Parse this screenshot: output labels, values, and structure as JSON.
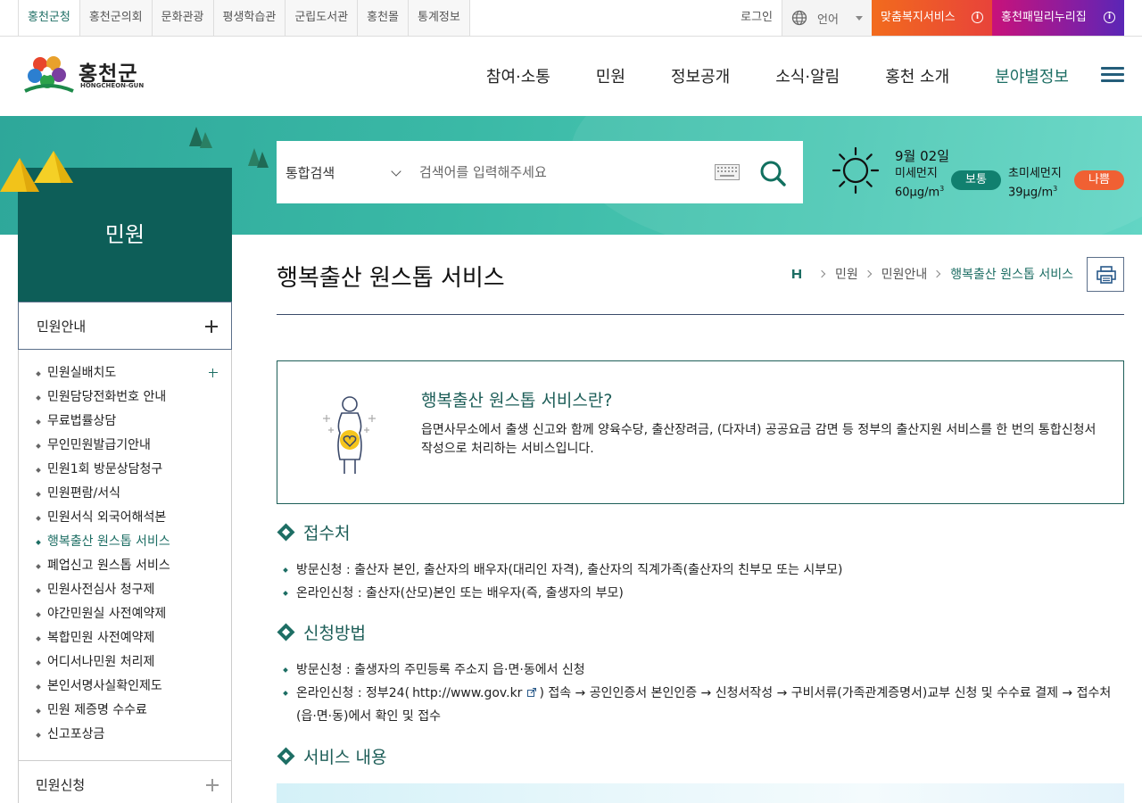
{
  "topbar": {
    "sites": [
      {
        "label": "홍천군청",
        "active": true
      },
      {
        "label": "홍천군의회"
      },
      {
        "label": "문화관광"
      },
      {
        "label": "평생학습관"
      },
      {
        "label": "군립도서관"
      },
      {
        "label": "홍천몰"
      },
      {
        "label": "통계정보"
      }
    ],
    "login": "로그인",
    "language": "언어",
    "promo_welfare": "맞춤복지서비스",
    "promo_family": "홍천패밀리누리집"
  },
  "header": {
    "logo_name": "홍천군",
    "logo_eng": "HONGCHEON-GUN",
    "gnb": [
      {
        "label": "참여·소통"
      },
      {
        "label": "민원"
      },
      {
        "label": "정보공개"
      },
      {
        "label": "소식·알림"
      },
      {
        "label": "홍천 소개"
      },
      {
        "label": "분야별정보",
        "active": true
      }
    ]
  },
  "search": {
    "scope": "통합검색",
    "placeholder": "검색어를 입력해주세요"
  },
  "weather": {
    "date": "9월 02일",
    "pm10_label": "미세먼지",
    "pm10_value": "60μg/m",
    "pm10_unit_exp": "3",
    "pm10_status": "보통",
    "pm25_label": "초미세먼지",
    "pm25_value": "39μg/m",
    "pm25_unit_exp": "3",
    "pm25_status": "나쁨"
  },
  "lnb": {
    "title": "민원",
    "group_open": "민원안내",
    "items": [
      {
        "label": "민원실배치도",
        "has_sub": true
      },
      {
        "label": "민원담당전화번호 안내"
      },
      {
        "label": "무료법률상담"
      },
      {
        "label": "무인민원발급기안내"
      },
      {
        "label": "민원1회 방문상담청구"
      },
      {
        "label": "민원편람/서식"
      },
      {
        "label": "민원서식 외국어해석본"
      },
      {
        "label": "행복출산 원스톱 서비스",
        "active": true
      },
      {
        "label": "폐업신고 원스톱 서비스"
      },
      {
        "label": "민원사전심사 청구제"
      },
      {
        "label": "야간민원실 사전예약제"
      },
      {
        "label": "복합민원 사전예약제"
      },
      {
        "label": "어디서나민원 처리제"
      },
      {
        "label": "본인서명사실확인제도"
      },
      {
        "label": "민원 제증명 수수료"
      },
      {
        "label": "신고포상금"
      }
    ],
    "group_closed": "민원신청"
  },
  "content": {
    "page_title": "행복출산 원스톱 서비스",
    "breadcrumb": [
      "민원",
      "민원안내",
      "행복출산 원스톱 서비스"
    ],
    "intro_title": "행복출산 원스톱 서비스란?",
    "intro_text": "읍면사무소에서 출생 신고와 함께 양육수당, 출산장려금, (다자녀) 공공요금 감면 등 정부의 출산지원 서비스를 한 번의 통합신청서 작성으로 처리하는 서비스입니다.",
    "sections": [
      {
        "title": "접수처",
        "bullets": [
          "방문신청 : 출산자 본인, 출산자의 배우자(대리인 자격), 출산자의 직계가족(출산자의 친부모 또는 시부모)",
          "온라인신청 : 출산자(산모)본인 또는 배우자(즉, 출생자의 부모)"
        ]
      },
      {
        "title": "신청방법",
        "bullet1": "방문신청 : 출생자의 주민등록 주소지 읍·면·동에서 신청",
        "bullet2_prefix": "온라인신청 : 정부24(",
        "bullet2_url": "http://www.gov.kr",
        "bullet2_suffix": ") 접속 → 공인인증서 본인인증 → 신청서작성 → 구비서류(가족관계증명서)교부 신청 및 수수료 결제 → 접수처(읍·면·동)에서 확인 및 접수"
      },
      {
        "title": "서비스 내용"
      }
    ]
  },
  "colors": {
    "primary": "#1d6e64",
    "lnb_title_bg": "#0d5e58",
    "badge_normal": "#11806f",
    "badge_bad": "#f06033"
  },
  "icons": [
    "globe-icon",
    "info-icon",
    "hamburger-icon",
    "search-icon",
    "keyboard-icon",
    "sun-icon",
    "home-icon",
    "print-icon",
    "pregnant-woman-icon",
    "diamond-icon",
    "external-link-icon"
  ]
}
